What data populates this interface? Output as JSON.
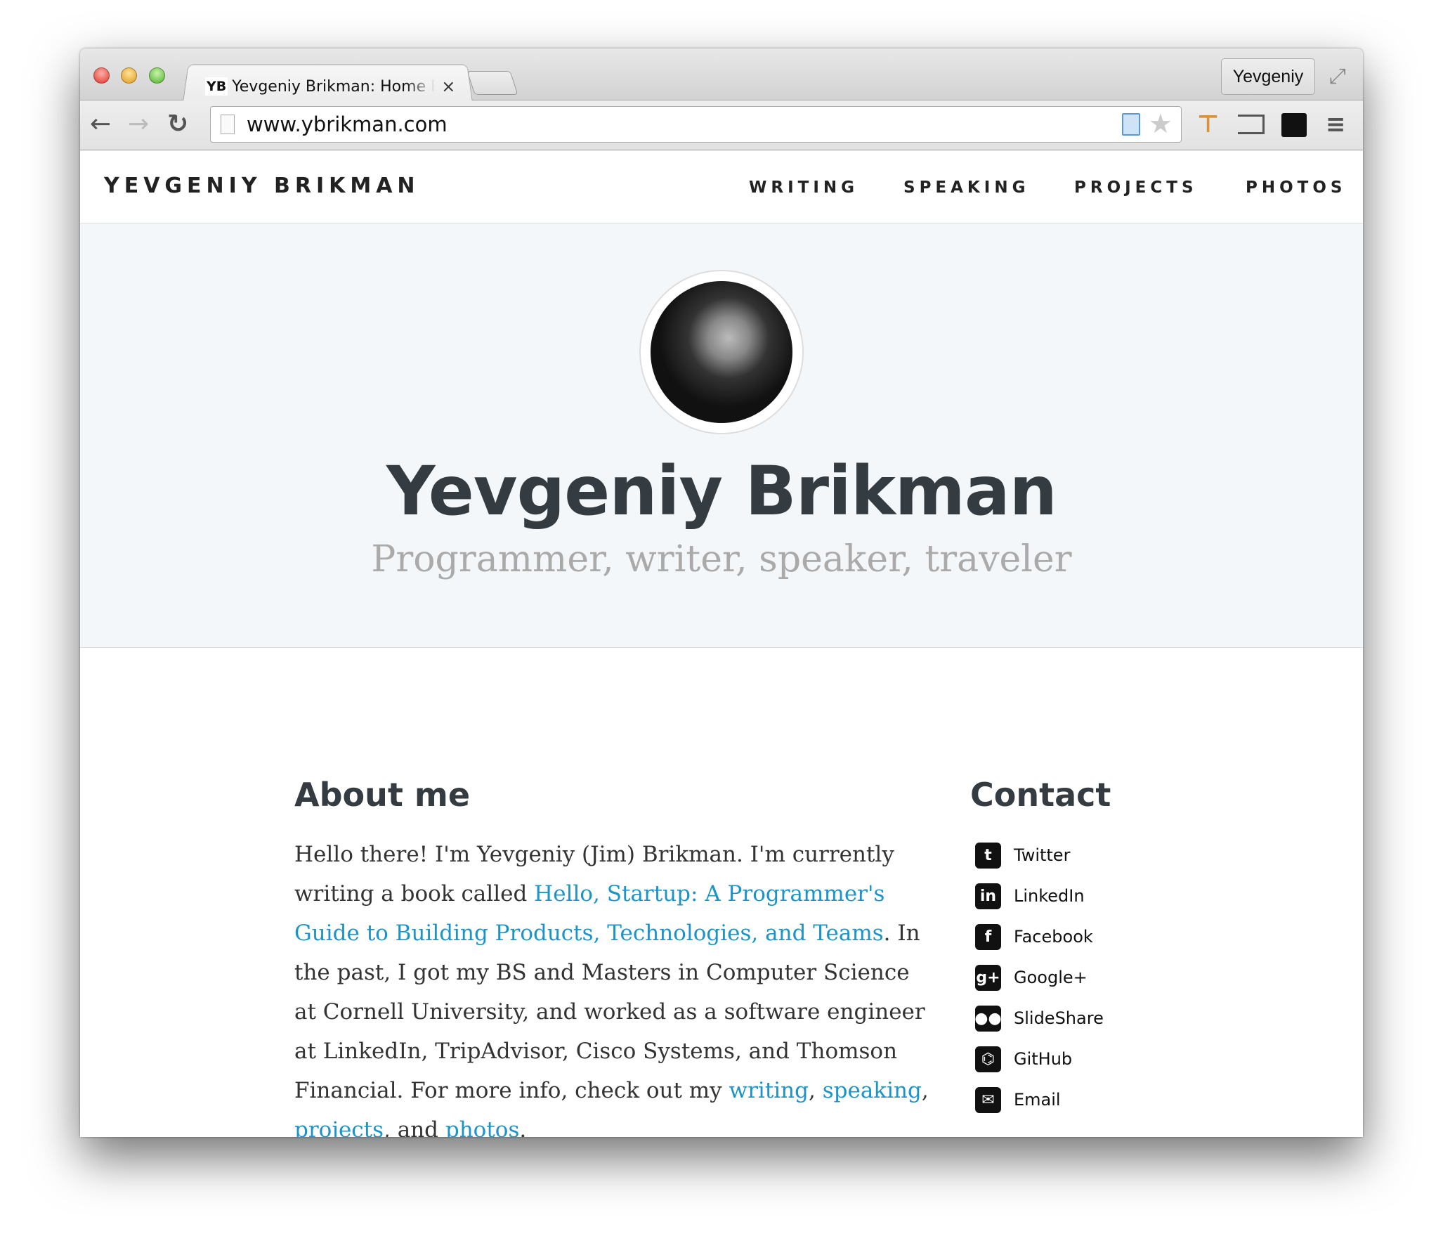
{
  "browser": {
    "tab": {
      "favicon": "YB",
      "title": "Yevgeniy Brikman: Home Page",
      "close": "×"
    },
    "profile": "Yevgeniy",
    "url": "www.ybrikman.com",
    "icons": [
      "back-icon",
      "forward-icon",
      "reload-icon",
      "page-icon",
      "reader-icon",
      "star-icon",
      "extension-icon",
      "cast-icon",
      "glasses-icon",
      "menu-icon",
      "fullscreen-icon"
    ]
  },
  "site": {
    "logo": "YEVGENIY BRIKMAN",
    "nav": [
      "WRITING",
      "SPEAKING",
      "PROJECTS",
      "PHOTOS"
    ],
    "hero": {
      "name": "Yevgeniy Brikman",
      "tagline": "Programmer, writer, speaker, traveler"
    },
    "about": {
      "heading": "About me",
      "p1": "Hello there! I'm Yevgeniy (Jim) Brikman. I'm currently writing a book called ",
      "book_link": "Hello, Startup: A Programmer's Guide to Building Products, Technologies, and Teams",
      "p2": ". In the past, I got my BS and Masters in Computer Science at Cornell University, and worked as a software engineer at LinkedIn, TripAdvisor, Cisco Systems, and Thomson Financial. For more info, check out my ",
      "links": [
        "writing",
        "speaking",
        "projects",
        "photos"
      ],
      "sep1": ", ",
      "sep2": ", ",
      "sep3": ", and ",
      "end": "."
    },
    "contact": {
      "heading": "Contact",
      "items": [
        {
          "label": "Twitter",
          "icon": "twitter-icon",
          "glyph": "t"
        },
        {
          "label": "LinkedIn",
          "icon": "linkedin-icon",
          "glyph": "in"
        },
        {
          "label": "Facebook",
          "icon": "facebook-icon",
          "glyph": "f"
        },
        {
          "label": "Google+",
          "icon": "googleplus-icon",
          "glyph": "g+"
        },
        {
          "label": "SlideShare",
          "icon": "slideshare-icon",
          "glyph": "●●"
        },
        {
          "label": "GitHub",
          "icon": "github-icon",
          "glyph": "⌬"
        },
        {
          "label": "Email",
          "icon": "email-icon",
          "glyph": "✉"
        }
      ]
    },
    "colors": {
      "link": "#1a94c9",
      "heading": "#343c42",
      "hero_bg": "#f4f7fa"
    }
  }
}
